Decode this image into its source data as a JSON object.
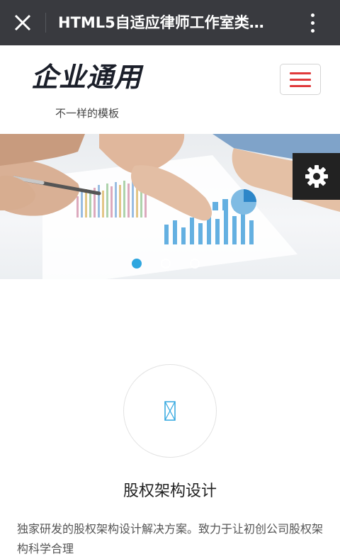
{
  "topbar": {
    "title": "HTML5自适应律师工作室类…",
    "close_icon": "close-icon",
    "more_icon": "more-vertical-icon"
  },
  "header": {
    "logo": "企业通用",
    "tagline": "不一样的模板",
    "menu_icon": "hamburger-menu-icon",
    "menu_color": "#e0393b"
  },
  "banner": {
    "slides": 3,
    "active_slide": 1,
    "accent": "#2fa6df"
  },
  "settings": {
    "icon": "gear-icon"
  },
  "feature": {
    "title": "股权架构设计",
    "description": "独家研发的股权架构设计解决方案。致力于让初创公司股权架构科学合理"
  }
}
